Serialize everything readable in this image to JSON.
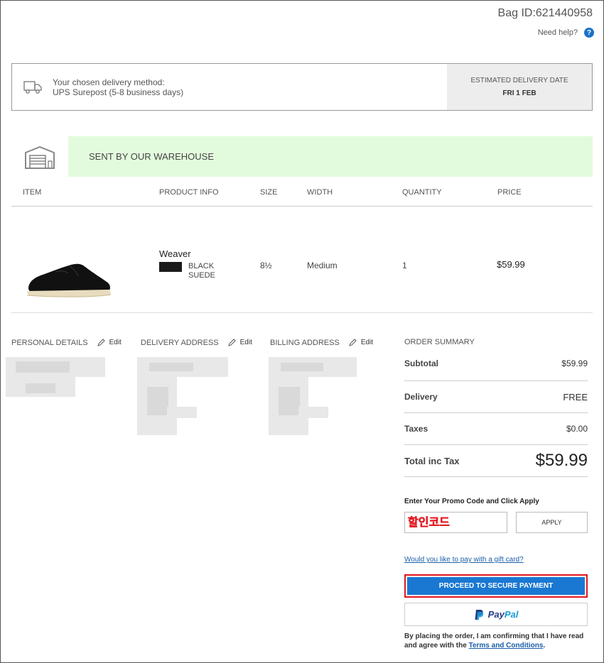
{
  "header": {
    "bag_id": "Bag ID:621440958",
    "help_text": "Need help?",
    "help_icon": "?"
  },
  "delivery": {
    "line1": "Your chosen delivery method:",
    "line2": "UPS Surepost (5-8 business days)",
    "est_label": "ESTIMATED DELIVERY DATE",
    "est_date": "FRI 1 FEB"
  },
  "warehouse": {
    "label": "SENT BY OUR WAREHOUSE",
    "color": "#e3fbdd"
  },
  "table": {
    "headers": [
      "ITEM",
      "PRODUCT INFO",
      "SIZE",
      "WIDTH",
      "QUANTITY",
      "PRICE"
    ],
    "item": {
      "name": "Weaver",
      "color_line1": "BLACK",
      "color_line2": "SUEDE",
      "size": "8½",
      "width": "Medium",
      "quantity": "1",
      "price": "$59.99"
    }
  },
  "sections": {
    "personal": "PERSONAL DETAILS",
    "delivery": "DELIVERY ADDRESS",
    "billing": "BILLING ADDRESS",
    "edit_label": "Edit"
  },
  "summary": {
    "title": "ORDER SUMMARY",
    "rows": [
      {
        "label": "Subtotal",
        "value": "$59.99"
      },
      {
        "label": "Delivery",
        "value": "FREE"
      },
      {
        "label": "Taxes",
        "value": "$0.00"
      },
      {
        "label": "Total inc Tax",
        "value": "$59.99"
      }
    ]
  },
  "promo": {
    "label": "Enter Your Promo Code and Click Apply",
    "value": "할인코드",
    "apply": "APPLY"
  },
  "payment": {
    "gift_link": "Would you like to pay with a gift card?",
    "proceed": "PROCEED TO SECURE PAYMENT",
    "paypal_a": "Pay",
    "paypal_b": "Pal",
    "terms_text": "By placing the order, I am confirming that I have read and agree with the ",
    "terms_link": "Terms and Conditions",
    "terms_end": ".",
    "accent": "#1a78d2",
    "highlight": "#e3141c"
  }
}
